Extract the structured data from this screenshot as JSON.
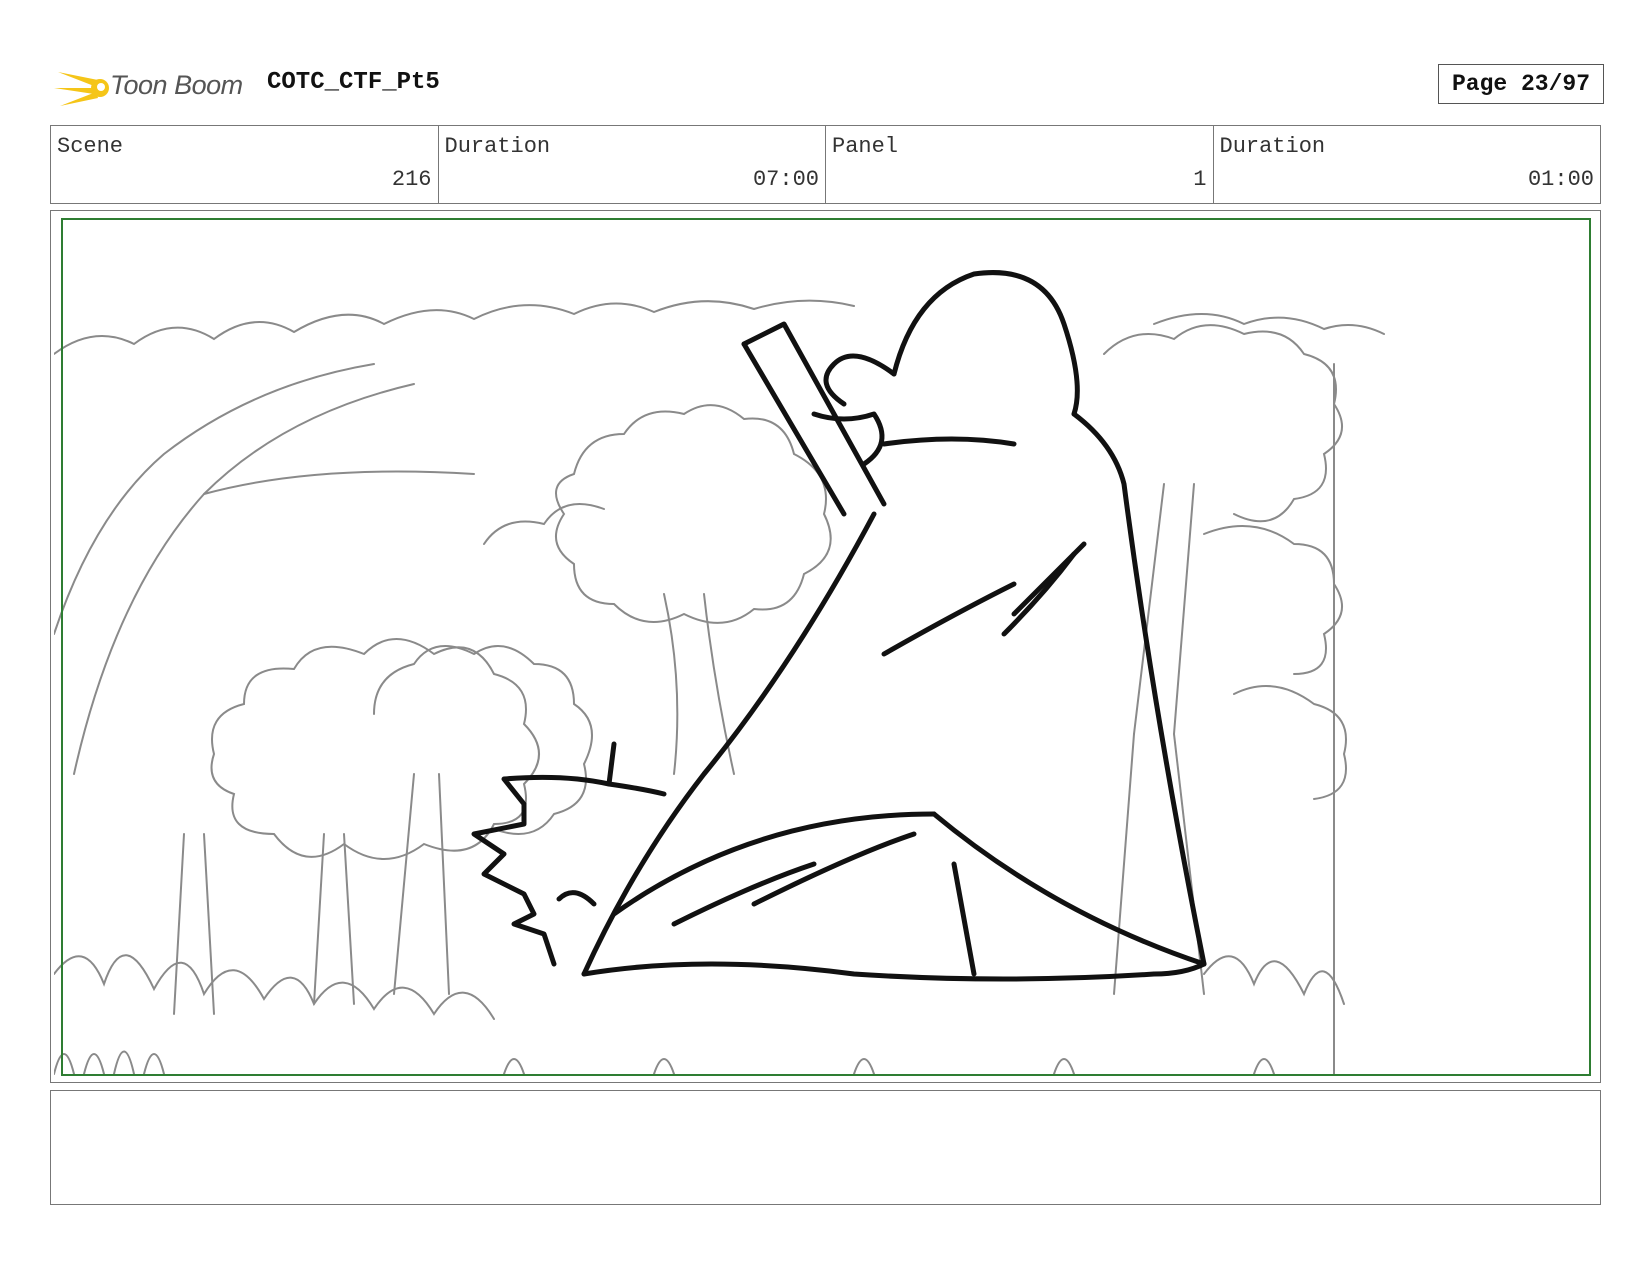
{
  "header": {
    "logo_text": "Toon Boom",
    "project_name": "COTC_CTF_Pt5",
    "page_label": "Page 23/97"
  },
  "info": {
    "scene_label": "Scene",
    "scene_value": "216",
    "scene_duration_label": "Duration",
    "scene_duration_value": "07:00",
    "panel_label": "Panel",
    "panel_value": "1",
    "panel_duration_label": "Duration",
    "panel_duration_value": "01:00"
  },
  "notes": {
    "text": ""
  },
  "colors": {
    "safe_frame": "#2e7d32",
    "logo_accent": "#f5c518"
  }
}
